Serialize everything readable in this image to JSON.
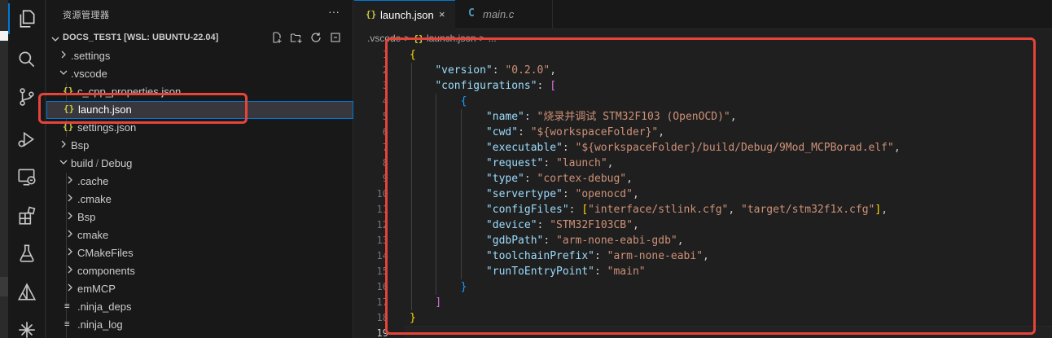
{
  "activity_bar": {
    "icons": [
      "explorer-icon",
      "search-icon",
      "source-control-icon",
      "run-debug-icon",
      "remote-explorer-icon",
      "extensions-icon",
      "testing-icon",
      "cmake-icon",
      "pio-icon"
    ]
  },
  "sidebar": {
    "title": "资源管理器",
    "more": "···",
    "workspace_title": "DOCS_TEST1 [WSL: UBUNTU-22.04]",
    "tree": [
      {
        "label": ".settings",
        "type": "folder",
        "expanded": false,
        "depth": 1
      },
      {
        "label": ".vscode",
        "type": "folder",
        "expanded": true,
        "depth": 1
      },
      {
        "label": "c_cpp_properties.json",
        "type": "json",
        "depth": 2
      },
      {
        "label": "launch.json",
        "type": "json",
        "depth": 2,
        "selected": true
      },
      {
        "label": "settings.json",
        "type": "json",
        "depth": 2
      },
      {
        "label": "Bsp",
        "type": "folder",
        "expanded": false,
        "depth": 1
      },
      {
        "label": "build",
        "label2": "Debug",
        "type": "folder",
        "expanded": true,
        "depth": 1
      },
      {
        "label": ".cache",
        "type": "folder",
        "expanded": false,
        "depth": 2
      },
      {
        "label": ".cmake",
        "type": "folder",
        "expanded": false,
        "depth": 2
      },
      {
        "label": "Bsp",
        "type": "folder",
        "expanded": false,
        "depth": 2
      },
      {
        "label": "cmake",
        "type": "folder",
        "expanded": false,
        "depth": 2
      },
      {
        "label": "CMakeFiles",
        "type": "folder",
        "expanded": false,
        "depth": 2
      },
      {
        "label": "components",
        "type": "folder",
        "expanded": false,
        "depth": 2
      },
      {
        "label": "emMCP",
        "type": "folder",
        "expanded": false,
        "depth": 2
      },
      {
        "label": ".ninja_deps",
        "type": "file",
        "depth": 2
      },
      {
        "label": ".ninja_log",
        "type": "file",
        "depth": 2
      }
    ]
  },
  "tabs": [
    {
      "icon": "{}",
      "label": "launch.json",
      "close": "×",
      "active": true
    },
    {
      "icon": "C",
      "label": "main.c",
      "active": false
    }
  ],
  "breadcrumb": {
    "part1": ".vscode",
    "sep": ">",
    "icon": "{}",
    "part2": "launch.json",
    "part3": "..."
  },
  "code_lines": [
    {
      "n": "1"
    },
    {
      "n": "2"
    },
    {
      "n": "3"
    },
    {
      "n": "4"
    },
    {
      "n": "5"
    },
    {
      "n": "6"
    },
    {
      "n": "7"
    },
    {
      "n": "8"
    },
    {
      "n": "9"
    },
    {
      "n": "10"
    },
    {
      "n": "11"
    },
    {
      "n": "12"
    },
    {
      "n": "13"
    },
    {
      "n": "14"
    },
    {
      "n": "15"
    },
    {
      "n": "16"
    },
    {
      "n": "17"
    },
    {
      "n": "18"
    },
    {
      "n": "19"
    }
  ],
  "launch_config": {
    "version_key": "\"version\"",
    "version": "\"0.2.0\"",
    "configurations_key": "\"configurations\"",
    "name_key": "\"name\"",
    "name": "\"烧录并调试 STM32F103 (OpenOCD)\"",
    "cwd_key": "\"cwd\"",
    "cwd": "\"${workspaceFolder}\"",
    "executable_key": "\"executable\"",
    "executable": "\"${workspaceFolder}/build/Debug/9Mod_MCPBorad.elf\"",
    "request_key": "\"request\"",
    "request": "\"launch\"",
    "type_key": "\"type\"",
    "type": "\"cortex-debug\"",
    "servertype_key": "\"servertype\"",
    "servertype": "\"openocd\"",
    "configFiles_key": "\"configFiles\"",
    "configFiles_0": "\"interface/stlink.cfg\"",
    "configFiles_1": "\"target/stm32f1x.cfg\"",
    "device_key": "\"device\"",
    "device": "\"STM32F103CB\"",
    "gdbPath_key": "\"gdbPath\"",
    "gdbPath": "\"arm-none-eabi-gdb\"",
    "toolchainPrefix_key": "\"toolchainPrefix\"",
    "toolchainPrefix": "\"arm-none-eabi\"",
    "runToEntryPoint_key": "\"runToEntryPoint\"",
    "runToEntryPoint": "\"main\""
  },
  "colors": {
    "accent": "#0078d4",
    "annotation": "#e5443a",
    "json_icon": "#cbcb41",
    "c_icon": "#519aba"
  }
}
